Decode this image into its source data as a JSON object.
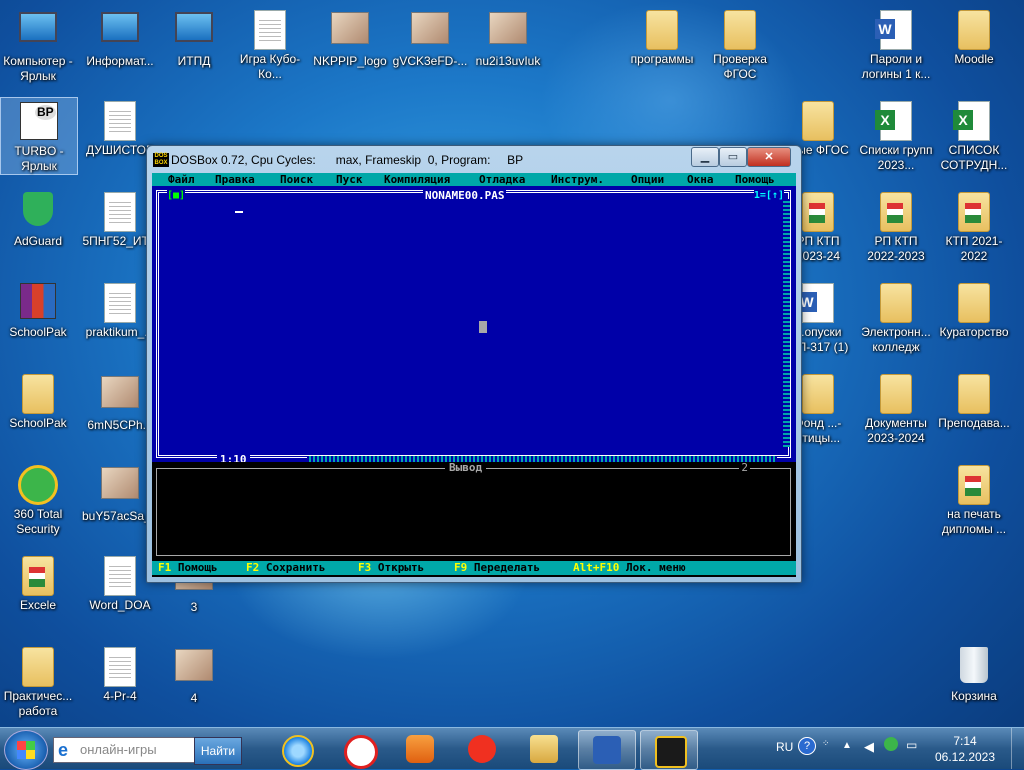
{
  "desktop_icons": [
    {
      "id": "computer",
      "label": "Компьютер - Ярлык",
      "icon": "computer-icon"
    },
    {
      "id": "inform",
      "label": "Информат...",
      "icon": "shortcut-icon"
    },
    {
      "id": "itpd",
      "label": "ИТПД",
      "icon": "shortcut-icon"
    },
    {
      "id": "igra",
      "label": "Игра Кубо-Ко...",
      "icon": "document-icon"
    },
    {
      "id": "nkppip",
      "label": "NKPPIP_logo",
      "icon": "image-icon"
    },
    {
      "id": "gvck",
      "label": "gVCK3eFD-...",
      "icon": "image-icon"
    },
    {
      "id": "nu2i",
      "label": "nu2i13uvIuk",
      "icon": "image-icon"
    },
    {
      "id": "programmy",
      "label": "программы",
      "icon": "folder-icon"
    },
    {
      "id": "proverka",
      "label": "Проверка ФГОС",
      "icon": "folder-icon"
    },
    {
      "id": "paroli",
      "label": "Пароли и логины 1 к...",
      "icon": "word-icon"
    },
    {
      "id": "moodle",
      "label": "Moodle",
      "icon": "folder-icon"
    },
    {
      "id": "turbo",
      "label": "TURBO - Ярлык",
      "icon": "turbo-pascal-icon"
    },
    {
      "id": "dushistor",
      "label": "ДУШИСТОР",
      "icon": "document-icon"
    },
    {
      "id": "novye_fgos",
      "label": "...ые ФГОС",
      "icon": "folder-icon"
    },
    {
      "id": "spiski",
      "label": "Списки групп 2023...",
      "icon": "excel-icon"
    },
    {
      "id": "spisok",
      "label": "СПИСОК СОТРУДН...",
      "icon": "excel-icon"
    },
    {
      "id": "adguard",
      "label": "AdGuard",
      "icon": "shield-icon"
    },
    {
      "id": "5png",
      "label": "5ПНГ52_ИТ...",
      "icon": "document-icon"
    },
    {
      "id": "rp_ktp_1",
      "label": "РП КТП 2023-24",
      "icon": "folder-icon"
    },
    {
      "id": "rp_ktp_2",
      "label": "РП КТП 2022-2023",
      "icon": "folder-icon"
    },
    {
      "id": "ktp",
      "label": "КТП 2021-2022",
      "icon": "folder-icon"
    },
    {
      "id": "schoolpak1",
      "label": "SchoolPak",
      "icon": "winrar-icon"
    },
    {
      "id": "praktikum",
      "label": "praktikum_...",
      "icon": "document-icon"
    },
    {
      "id": "propuski",
      "label": "...опуски ...П-317 (1)",
      "icon": "word-icon"
    },
    {
      "id": "elektronny",
      "label": "Электронн... колледж",
      "icon": "folder-icon"
    },
    {
      "id": "kuratorstvo",
      "label": "Кураторство",
      "icon": "folder-icon"
    },
    {
      "id": "schoolpak2",
      "label": "SchoolPak",
      "icon": "folder-icon"
    },
    {
      "id": "6mn5",
      "label": "6mN5CPh...",
      "icon": "image-icon"
    },
    {
      "id": "fond",
      "label": "Фонд ...-птицы...",
      "icon": "folder-icon"
    },
    {
      "id": "dokumenty",
      "label": "Документы 2023-2024",
      "icon": "folder-icon"
    },
    {
      "id": "prepodava",
      "label": "Преподава...",
      "icon": "folder-icon"
    },
    {
      "id": "360",
      "label": "360 Total Security",
      "icon": "security-icon"
    },
    {
      "id": "buy57",
      "label": "buY57acSa_...",
      "icon": "image-icon"
    },
    {
      "id": "na_pechat",
      "label": "на печать дипломы ...",
      "icon": "folder-icon"
    },
    {
      "id": "excele",
      "label": "Excele",
      "icon": "folder-icon"
    },
    {
      "id": "word_doa",
      "label": "Word_DOA",
      "icon": "document-icon"
    },
    {
      "id": "n3",
      "label": "3",
      "icon": "image-icon"
    },
    {
      "id": "praktich",
      "label": "Практичес... работа",
      "icon": "folder-icon"
    },
    {
      "id": "4pr4",
      "label": "4-Pr-4",
      "icon": "document-icon"
    },
    {
      "id": "n4",
      "label": "4",
      "icon": "image-icon"
    },
    {
      "id": "korzina",
      "label": "Корзина",
      "icon": "recycle-bin-icon"
    }
  ],
  "dosbox": {
    "title": "DOSBox 0.72, Cpu Cycles:      max, Frameskip  0, Program:     BP",
    "logo": "DOS BOX",
    "menu": [
      "Файл",
      "Правка",
      "Поиск",
      "Пуск",
      "Компиляция",
      "Отладка",
      "Инструм.",
      "Опции",
      "Окна",
      "Помощь"
    ],
    "editor": {
      "filename": "NONAME00.PAS",
      "close_marker": "[■]",
      "window_number": "1=[↑]",
      "cursor_position": "1:10"
    },
    "output": {
      "title": "Вывод",
      "number": "2"
    },
    "status_bar": [
      {
        "key": "F1",
        "label": "Помощь"
      },
      {
        "key": "F2",
        "label": "Сохранить"
      },
      {
        "key": "F3",
        "label": "Открыть"
      },
      {
        "key": "F9",
        "label": "Переделать"
      },
      {
        "key": "Alt+F10",
        "label": "Лок. меню"
      }
    ]
  },
  "taskbar": {
    "search_placeholder": "онлайн-игры",
    "search_button": "Найти",
    "apps": [
      {
        "id": "ie",
        "icon": "internet-explorer-icon"
      },
      {
        "id": "yandex_browser",
        "icon": "yandex-browser-icon"
      },
      {
        "id": "media",
        "icon": "media-player-icon"
      },
      {
        "id": "yandex",
        "icon": "yandex-icon"
      },
      {
        "id": "explorer",
        "icon": "file-explorer-icon"
      },
      {
        "id": "word",
        "icon": "word-icon"
      },
      {
        "id": "dosbox",
        "icon": "dosbox-icon"
      }
    ],
    "tray": {
      "language": "RU",
      "time": "7:14",
      "date": "06.12.2023"
    }
  },
  "colors": {
    "dos_blue": "#0000a8",
    "dos_cyan": "#00a8a8",
    "dos_yellow": "#ffff00"
  }
}
